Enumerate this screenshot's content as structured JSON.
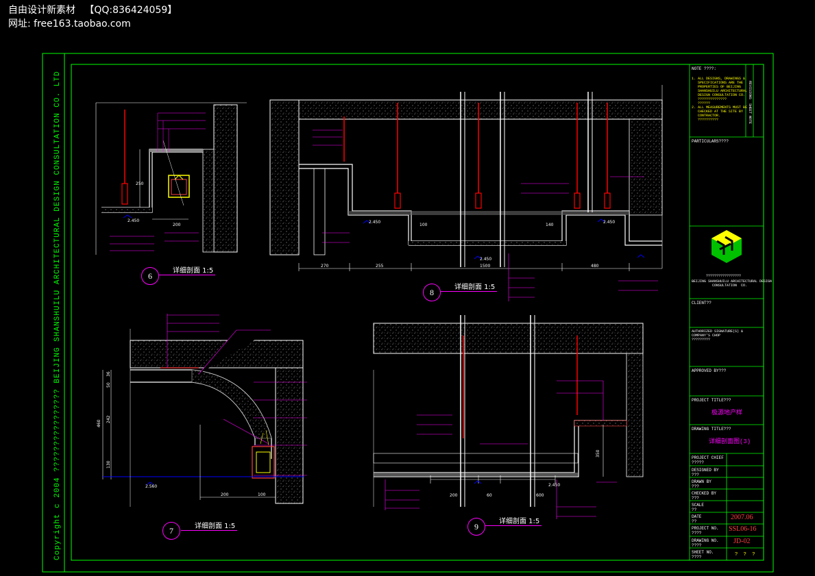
{
  "watermark": {
    "line1": "自由设计新素材   【QQ:836424059】",
    "line2": "网址: free163.taobao.com"
  },
  "border_text": {
    "left_vertical": "Copyright  c  2004  ????????????????   BEIJING SHANSHUILU ARCHITECTURAL DESIGN CONSULTATION  CO. LTD"
  },
  "title_block": {
    "note_heading": "NOTE ????:",
    "note_lines": "1. ALL DESIGNS, DRAWINGS &\n   SPECIFICATIONS ARE THE\n   PROPERTIES OF BEIJING\n   SHANSHUILU ARCHITECTURAL\n   DESIGN CONSULTATION CO.\n   ??????????????\n   ??????\n2. ALL MEASUREMENTS MUST BE\n   CHECKED AT THE SITE BY\n   CONTRACTOR.\n   ??????????",
    "particulars": "PARTICULARS????",
    "company_en": "BEIJING SHANSHUILU ARCHITECTURAL DESIGN\n          CONSULTATION  CO.",
    "company_cn": "?????????????????",
    "client": "CLIENT??",
    "authorized": "AUTHORIZED SIGNATURE(S) &\nCOMPANY'S CHOP\n?????????",
    "approved": "APPROVED BY???",
    "project_title_label": "PROJECT TITLE???",
    "project_title_value": "极源地产样",
    "drawing_title_label": "DRAWING TITLE???",
    "drawing_title_value": "详细剖面图(3)",
    "project_chief": "PROJECT CHIEF\n?????",
    "designed_by": "DESIGNED BY\n???",
    "drawn_by": "DRAWN BY\n???",
    "checked_by": "CHECKED BY\n???",
    "scale": "SCALE\n??",
    "date_label": "DATE\n??",
    "date_value": "2007.06",
    "project_no_label": "PROJECT NO.\n????",
    "project_no_value": "SSL06-16",
    "drawing_no_label": "DRAWING NO.\n????",
    "drawing_no_value": "JD-02",
    "sheet_no_label": "SHEET NO.\n????",
    "sheet_no_value": "?  ?  ?",
    "right_strip": "REVISIONS  SHEET NOTE"
  },
  "sections": [
    {
      "number": "6",
      "caption": "详细剖面 1:5"
    },
    {
      "number": "8",
      "caption": "详细剖面 1:5"
    },
    {
      "number": "7",
      "caption": "详细剖面 1:5"
    },
    {
      "number": "9",
      "caption": "详细剖面 1:5"
    }
  ],
  "dims": {
    "s6": [
      "200",
      "250",
      "2.450"
    ],
    "s8": [
      "270",
      "255",
      "1500",
      "480",
      "100",
      "140",
      "2.450",
      "2.450",
      "2.450"
    ],
    "s7": [
      "460",
      "242",
      "50",
      "36",
      "130",
      "200",
      "100",
      "2.560"
    ],
    "s9": [
      "200",
      "60",
      "600",
      "350",
      "2.450"
    ]
  },
  "colors": {
    "frame": "#00ff00",
    "wall": "#ffffff",
    "hatch": "#808080",
    "dim": "#ffffff",
    "leader": "#ff00ff",
    "hanger": "#ff0000",
    "accent": "#ffff00",
    "level": "#0000ff",
    "logo_green": "#00c000",
    "logo_yellow": "#ffff00"
  }
}
